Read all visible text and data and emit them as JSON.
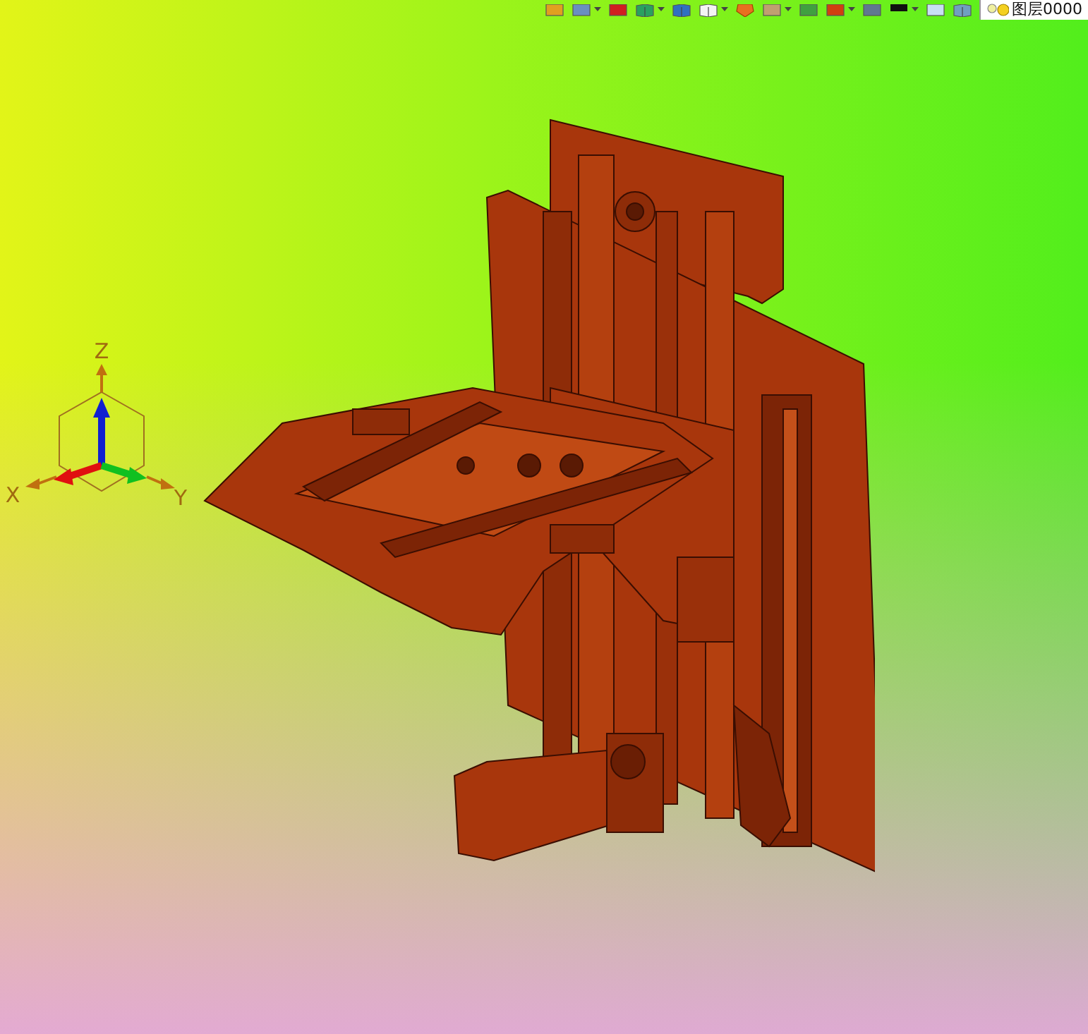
{
  "toolbar": {
    "layer": {
      "value": "图层0000"
    }
  },
  "axis_triad": {
    "labels": [
      {
        "kind": "z",
        "text": "Z"
      },
      {
        "kind": "x",
        "text": "X"
      },
      {
        "kind": "y",
        "text": "Y"
      }
    ]
  }
}
